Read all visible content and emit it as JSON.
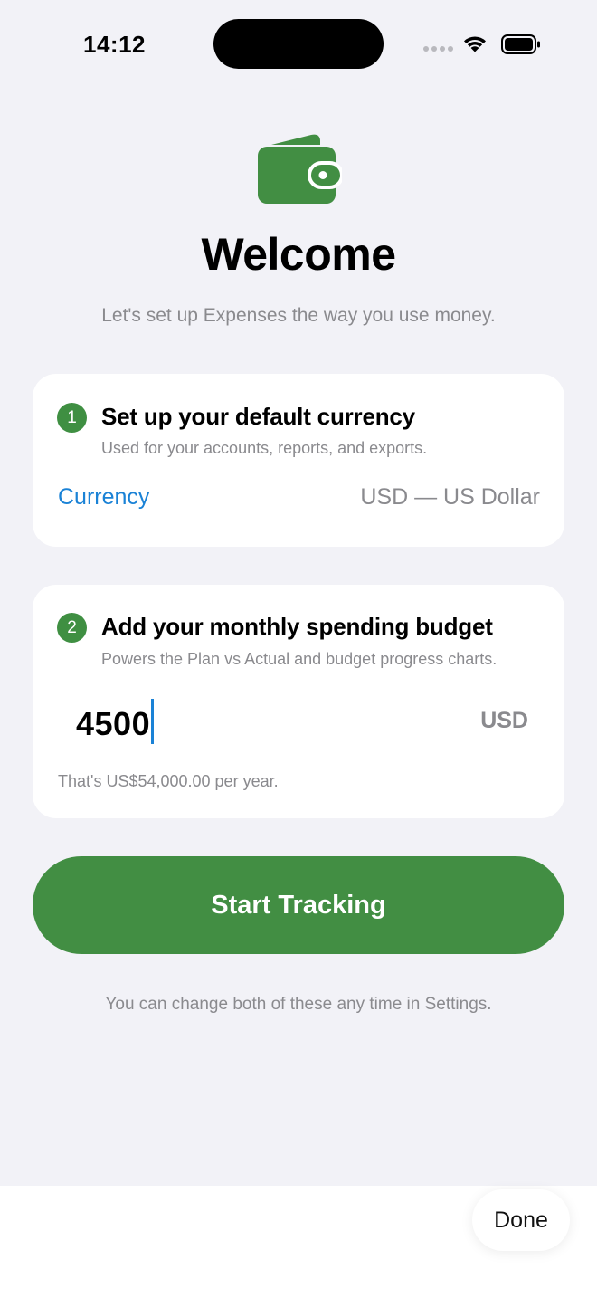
{
  "status_bar": {
    "time": "14:12"
  },
  "header": {
    "icon": "wallet-icon",
    "title": "Welcome",
    "subtitle": "Let's set up Expenses the way you use money."
  },
  "step1": {
    "number": "1",
    "title": "Set up your default currency",
    "description": "Used for your accounts, reports, and exports.",
    "currency_label": "Currency",
    "currency_value": "USD — US Dollar"
  },
  "step2": {
    "number": "2",
    "title": "Add your monthly spending budget",
    "description": "Powers the Plan vs Actual and budget progress charts.",
    "budget_value": "4500",
    "budget_currency": "USD",
    "yearly_note": "That's US$54,000.00 per year."
  },
  "start_button": {
    "label": "Start Tracking"
  },
  "footer_note": "You can change both of these any time in Settings.",
  "keyboard_bar": {
    "done_label": "Done"
  },
  "colors": {
    "accent_green": "#428e43",
    "link_blue": "#1a82d6",
    "background": "#f2f2f7"
  }
}
